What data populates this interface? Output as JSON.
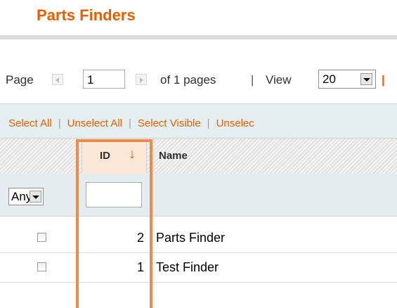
{
  "page": {
    "title": "Parts Finders"
  },
  "pager": {
    "page_label": "Page",
    "current_page": "1",
    "of_pages": "of 1 pages",
    "separator": "|",
    "view_label": "View",
    "view_value": "20",
    "trailing_separator": "|"
  },
  "massaction": {
    "select_all": "Select All",
    "unselect_all": "Unselect All",
    "select_visible": "Select Visible",
    "unselect_visible": "Unselec",
    "separator": "|"
  },
  "grid": {
    "headers": {
      "id": "ID",
      "sort_arrow": "↓",
      "name": "Name"
    },
    "filters": {
      "checkbox_filter": "Any",
      "id_value": ""
    },
    "rows": [
      {
        "id": "2",
        "name": "Parts Finder",
        "checked": false
      },
      {
        "id": "1",
        "name": "Test Finder",
        "checked": false
      }
    ]
  },
  "colors": {
    "accent": "#eb5e00",
    "highlight_frame": "#f08a4b",
    "sorted_column_bg": "#fbe7d6",
    "filter_row_bg": "#e4ecef"
  },
  "icons": {
    "pager_prev": "arrow-left-icon",
    "pager_next": "arrow-right-icon",
    "dropdown": "chevron-down-icon",
    "sort": "sort-descending-icon"
  }
}
